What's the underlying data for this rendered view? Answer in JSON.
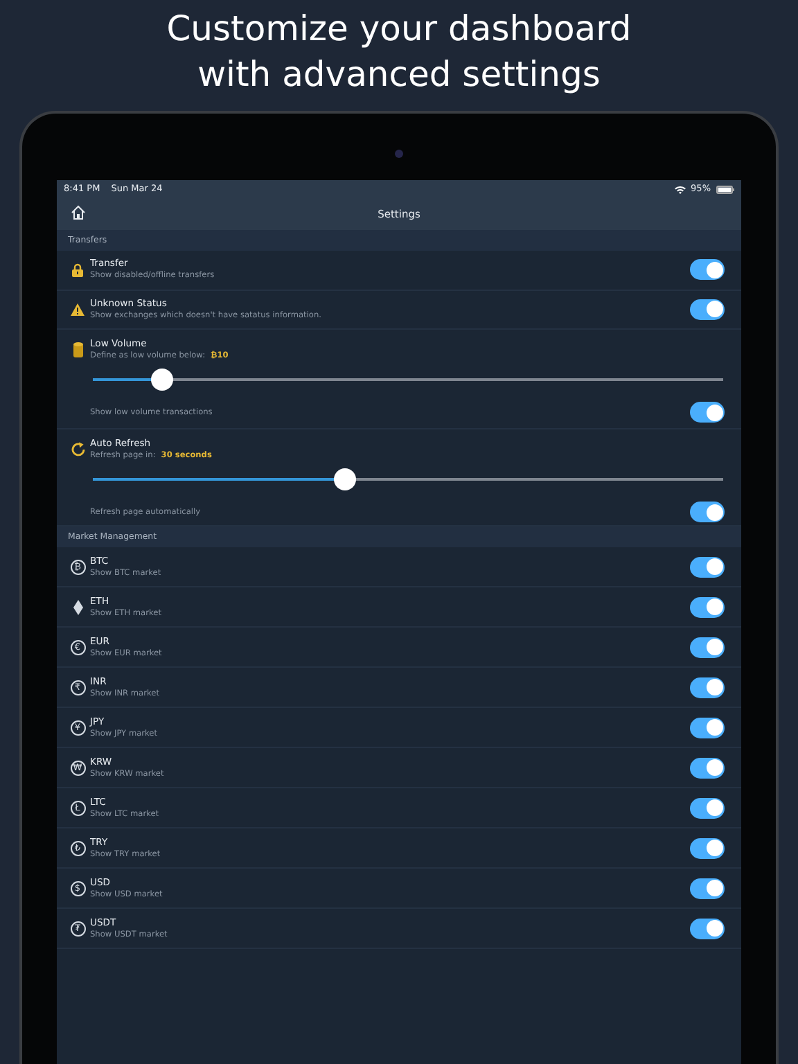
{
  "headline": "Customize your dashboard\nwith advanced settings",
  "status_bar": {
    "time": "8:41 PM",
    "date": "Sun Mar 24",
    "battery_text": "95%"
  },
  "nav": {
    "title": "Settings"
  },
  "sections": [
    {
      "header": "Transfers",
      "rows": [
        {
          "kind": "toggle",
          "title": "Transfer",
          "subtitle": "Show disabled/offline transfers",
          "on": true
        },
        {
          "kind": "toggle",
          "title": "Unknown Status",
          "subtitle": "Show exchanges which doesn't have satatus information.",
          "on": true
        },
        {
          "kind": "slider",
          "title": "Low Volume",
          "subtitle": "Define as low volume below:",
          "value": "₿10",
          "level": 0.11,
          "toggle_label": "Show low volume transactions",
          "on": true
        },
        {
          "kind": "slider",
          "title": "Auto Refresh",
          "subtitle": "Refresh page in:",
          "value": "30 seconds",
          "level": 0.4,
          "toggle_label": "Refresh page automatically",
          "on": true
        }
      ]
    },
    {
      "header": "Market Management",
      "rows": [
        {
          "kind": "market",
          "glyph": "₿",
          "title": "BTC",
          "subtitle": "Show BTC market",
          "on": true
        },
        {
          "kind": "market",
          "title": "ETH",
          "subtitle": "Show ETH market",
          "on": true
        },
        {
          "kind": "market",
          "glyph": "€",
          "title": "EUR",
          "subtitle": "Show EUR market",
          "on": true
        },
        {
          "kind": "market",
          "glyph": "₹",
          "title": "INR",
          "subtitle": "Show INR market",
          "on": true
        },
        {
          "kind": "market",
          "glyph": "¥",
          "title": "JPY",
          "subtitle": "Show JPY market",
          "on": true
        },
        {
          "kind": "market",
          "glyph": "₩",
          "title": "KRW",
          "subtitle": "Show KRW market",
          "on": true
        },
        {
          "kind": "market",
          "glyph": "Ł",
          "title": "LTC",
          "subtitle": "Show LTC market",
          "on": true
        },
        {
          "kind": "market",
          "glyph": "₺",
          "title": "TRY",
          "subtitle": "Show TRY market",
          "on": true
        },
        {
          "kind": "market",
          "glyph": "$",
          "title": "USD",
          "subtitle": "Show USD market",
          "on": true
        },
        {
          "kind": "market",
          "glyph": "₮",
          "title": "USDT",
          "subtitle": "Show USDT market",
          "on": true
        }
      ]
    }
  ]
}
